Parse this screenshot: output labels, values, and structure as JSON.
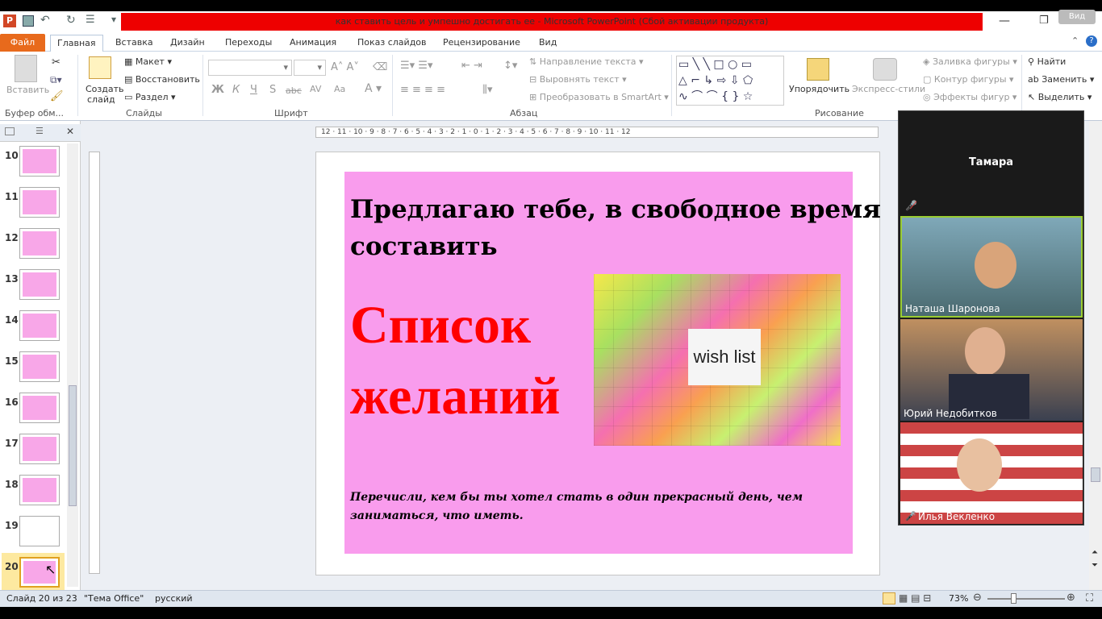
{
  "window": {
    "title": "как ставить цель и умпешно достигать ее  -  Microsoft PowerPoint (Сбой активации продукта)"
  },
  "tabs": [
    "Файл",
    "Главная",
    "Вставка",
    "Дизайн",
    "Переходы",
    "Анимация",
    "Показ слайдов",
    "Рецензирование",
    "Вид"
  ],
  "ribbon": {
    "clipboard": {
      "paste": "Вставить",
      "group": "Буфер обм..."
    },
    "slides": {
      "create": "Создать",
      "create2": "слайд",
      "layout": "Макет",
      "reset": "Восстановить",
      "section": "Раздел",
      "group": "Слайды"
    },
    "font": {
      "group": "Шрифт",
      "bold": "Ж",
      "italic": "К",
      "underline": "Ч",
      "strike": "abc",
      "spacing": "AV",
      "case": "Aa"
    },
    "paragraph": {
      "group": "Абзац",
      "dir": "Направление текста",
      "align": "Выровнять текст",
      "smartart": "Преобразовать в SmartArt"
    },
    "drawing": {
      "group": "Рисование",
      "arrange": "Упорядочить",
      "styles": "Экспресс-стили",
      "fill": "Заливка фигуры",
      "outline": "Контур фигуры",
      "effects": "Эффекты фигур"
    },
    "editing": {
      "find": "Найти",
      "replace": "Заменить",
      "select": "Выделить"
    }
  },
  "thumbs": [
    "10",
    "11",
    "12",
    "13",
    "14",
    "15",
    "16",
    "17",
    "18",
    "19",
    "20"
  ],
  "ruler_top": "12 · 11 · 10 · 9 · 8 · 7 · 6 · 5 · 4 · 3 · 2 · 1 · 0 · 1 · 2 · 3 · 4 · 5 · 6 · 7 · 8 · 9 · 10 · 11 · 12",
  "slide": {
    "heading1": "Предлагаю  тебе, в свободное время",
    "heading2": "составить",
    "big1": "Список",
    "big2": "желаний",
    "image_text": "wish list",
    "footer1": "Перечисли, кем бы ты хотел стать в один прекрасный день, чем",
    "footer2": "заниматься, что иметь."
  },
  "zoom_panel": {
    "host": "Тамара",
    "participants": [
      "Наташа Шаронова",
      "Юрий Недобитков",
      "Илья Векленко"
    ],
    "view_label": "Вид"
  },
  "status": {
    "slide": "Слайд 20 из 23",
    "theme": "\"Тема Office\"",
    "lang": "русский",
    "zoom": "73%"
  },
  "colors": {
    "accent": "#e86a1c",
    "slide_bg": "#f99ced",
    "red_text": "#ff0000",
    "title_bar": "#e00000"
  }
}
